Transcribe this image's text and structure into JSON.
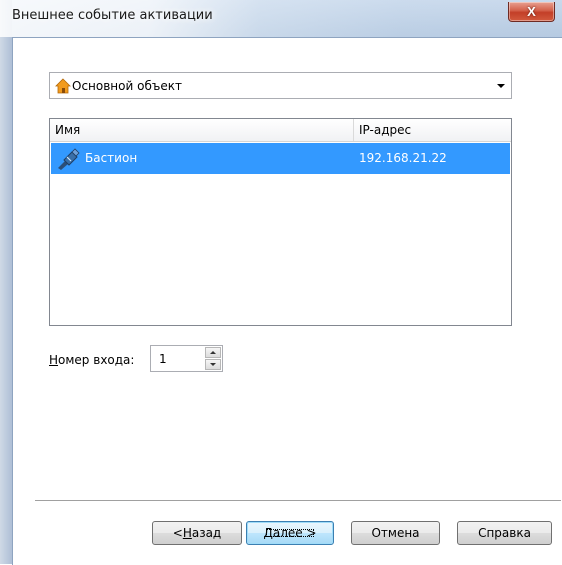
{
  "window": {
    "title": "Внешнее событие активации",
    "close_label": "X"
  },
  "object_selector": {
    "value": "Основной объект",
    "icon": "house-icon"
  },
  "list": {
    "columns": [
      "Имя",
      "IP-адрес"
    ],
    "rows": [
      {
        "name": "Бастион",
        "ip": "192.168.21.22",
        "icon": "device-icon",
        "selected": true
      }
    ]
  },
  "input": {
    "label_accel": "Н",
    "label_rest": "омер входа:",
    "value": "1"
  },
  "buttons": {
    "back_prefix": "< ",
    "back_accel": "Н",
    "back_rest": "азад",
    "next_accel": "Д",
    "next_rest": "алее >",
    "cancel": "Отмена",
    "help": "Справка"
  },
  "colors": {
    "selection": "#3399ff",
    "close_button": "#c33f28"
  }
}
